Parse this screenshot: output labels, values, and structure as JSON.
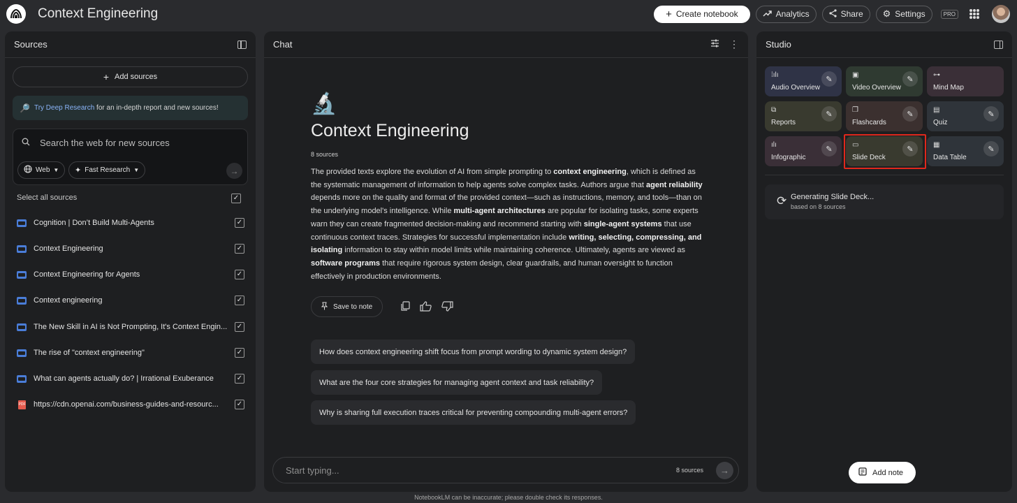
{
  "app": {
    "title": "Context Engineering"
  },
  "topbar": {
    "create_notebook": "Create notebook",
    "analytics": "Analytics",
    "share": "Share",
    "settings": "Settings",
    "pro_badge": "PRO"
  },
  "sources": {
    "header": "Sources",
    "add_sources": "Add sources",
    "deep_research_link": "Try Deep Research",
    "deep_research_text": " for an in-depth report and new sources!",
    "search_placeholder": "Search the web for new sources",
    "web_chip": "Web",
    "research_chip": "Fast Research",
    "select_all": "Select all sources",
    "items": [
      {
        "label": "Cognition | Don’t Build Multi-Agents",
        "icon": "web-icon"
      },
      {
        "label": "Context Engineering",
        "icon": "web-icon"
      },
      {
        "label": "Context Engineering for Agents",
        "icon": "web-icon"
      },
      {
        "label": "Context engineering",
        "icon": "web-icon"
      },
      {
        "label": "The New Skill in AI is Not Prompting, It's Context Engin...",
        "icon": "web-icon"
      },
      {
        "label": "The rise of \"context engineering\"",
        "icon": "web-icon"
      },
      {
        "label": "What can agents actually do? | Irrational Exuberance",
        "icon": "web-icon"
      },
      {
        "label": "https://cdn.openai.com/business-guides-and-resourc...",
        "icon": "pdf-icon"
      }
    ]
  },
  "chat": {
    "header": "Chat",
    "notebook_title": "Context Engineering",
    "source_count": "8 sources",
    "summary_parts": [
      {
        "t": "The provided texts explore the evolution of AI from simple prompting to ",
        "b": false
      },
      {
        "t": "context engineering",
        "b": true
      },
      {
        "t": ", which is defined as the systematic management of information to help agents solve complex tasks. Authors argue that ",
        "b": false
      },
      {
        "t": "agent reliability",
        "b": true
      },
      {
        "t": " depends more on the quality and format of the provided context—such as instructions, memory, and tools—than on the underlying model's intelligence. While ",
        "b": false
      },
      {
        "t": "multi-agent architectures",
        "b": true
      },
      {
        "t": " are popular for isolating tasks, some experts warn they can create fragmented decision-making and recommend starting with ",
        "b": false
      },
      {
        "t": "single-agent systems",
        "b": true
      },
      {
        "t": " that use continuous context traces. Strategies for successful implementation include ",
        "b": false
      },
      {
        "t": "writing, selecting, compressing, and isolating",
        "b": true
      },
      {
        "t": " information to stay within model limits while maintaining coherence. Ultimately, agents are viewed as ",
        "b": false
      },
      {
        "t": "software programs",
        "b": true
      },
      {
        "t": " that require rigorous system design, clear guardrails, and human oversight to function effectively in production environments.",
        "b": false
      }
    ],
    "save_to_note": "Save to note",
    "suggestions": [
      "How does context engineering shift focus from prompt wording to dynamic system design?",
      "What are the four core strategies for managing agent context and task reliability?",
      "Why is sharing full execution traces critical for preventing compounding multi-agent errors?"
    ],
    "input_placeholder": "Start typing...",
    "input_source_count": "8 sources"
  },
  "studio": {
    "header": "Studio",
    "tiles": [
      {
        "label": "Audio Overview",
        "icon": "audio-wave-icon",
        "color": "#2f3346"
      },
      {
        "label": "Video Overview",
        "icon": "video-icon",
        "color": "#2f3a31"
      },
      {
        "label": "Mind Map",
        "icon": "mind-map-icon",
        "color": "#3a2f37"
      },
      {
        "label": "Reports",
        "icon": "reports-icon",
        "color": "#393a2f"
      },
      {
        "label": "Flashcards",
        "icon": "flashcards-icon",
        "color": "#3b302f"
      },
      {
        "label": "Quiz",
        "icon": "quiz-icon",
        "color": "#2f343a"
      },
      {
        "label": "Infographic",
        "icon": "infographic-icon",
        "color": "#3a2f37"
      },
      {
        "label": "Slide Deck",
        "icon": "slides-icon",
        "color": "#393a2f"
      },
      {
        "label": "Data Table",
        "icon": "table-icon",
        "color": "#2f343a"
      }
    ],
    "generating_title": "Generating Slide Deck...",
    "generating_sub": "based on 8 sources",
    "add_note": "Add note"
  },
  "footer": "NotebookLM can be inaccurate; please double check its responses."
}
